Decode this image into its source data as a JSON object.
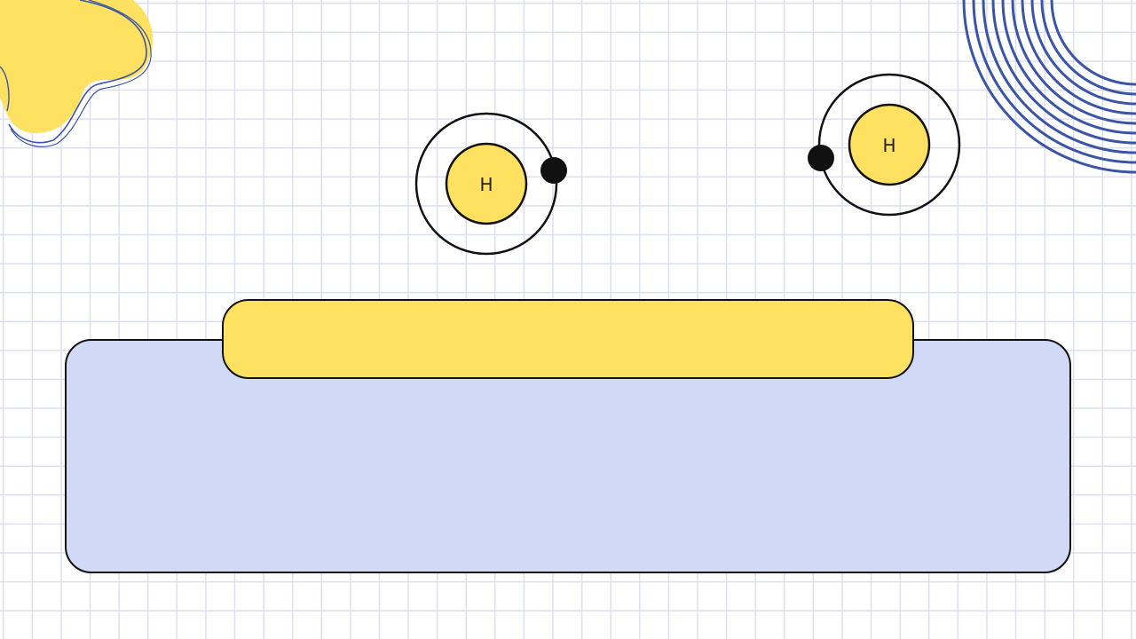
{
  "atoms": [
    {
      "symbol": "H",
      "electrons": 1
    },
    {
      "symbol": "H",
      "electrons": 1
    }
  ],
  "title_bar": {
    "text": ""
  },
  "main_panel": {
    "text": ""
  },
  "colors": {
    "nucleus": "#ffe161",
    "title_bar": "#ffe161",
    "panel": "#d0daf6",
    "outline": "#111111",
    "grid": "#dcdff0",
    "decor_blue": "#3a55a6",
    "decor_yellow": "#ffe161"
  }
}
